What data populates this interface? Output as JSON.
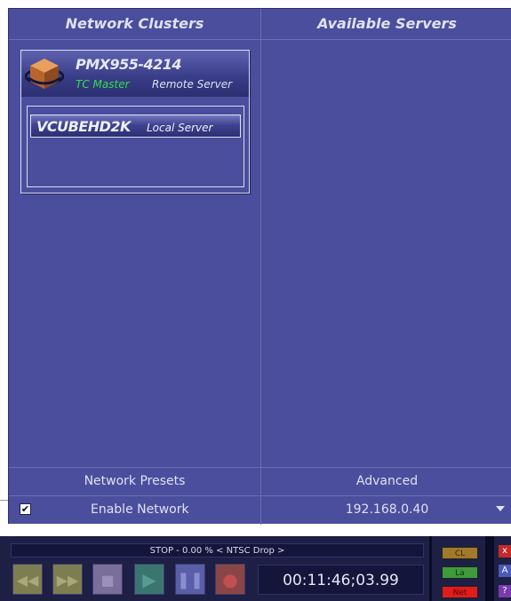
{
  "headers": {
    "left": "Network Clusters",
    "right": "Available Servers"
  },
  "cluster": {
    "name": "PMX955-4214",
    "role": "TC Master",
    "type": "Remote Server",
    "icon": "server-cube-icon",
    "local_server": {
      "name": "VCUBEHD2K",
      "type": "Local Server"
    }
  },
  "footer": {
    "presets_label": "Network Presets",
    "advanced_label": "Advanced",
    "enable_network_label": "Enable Network",
    "enable_network_checked": true,
    "ip_value": "192.168.0.40"
  },
  "transport": {
    "status": "STOP - 0.00 % < NTSC Drop >",
    "timecode": "00:11:46;03.99",
    "buttons": [
      "rewind",
      "fast-forward",
      "stop",
      "play",
      "pause",
      "record"
    ],
    "indicators": {
      "cl": "CL",
      "la": "La",
      "net": "Net"
    },
    "side_buttons": [
      "x",
      "A",
      "?"
    ]
  },
  "colors": {
    "panel": "#4a4e9c",
    "tc_master": "#2fe04a",
    "net": "#e01c1c"
  }
}
